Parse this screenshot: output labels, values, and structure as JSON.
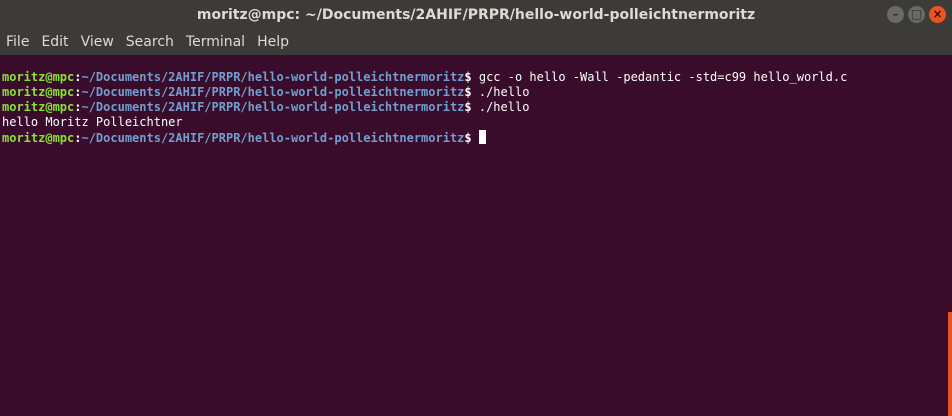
{
  "window": {
    "title": "moritz@mpc: ~/Documents/2AHIF/PRPR/hello-world-polleichtnermoritz",
    "buttons": {
      "minimize_glyph": "–",
      "maximize_glyph": "□",
      "close_glyph": "×"
    }
  },
  "menu": {
    "items": [
      "File",
      "Edit",
      "View",
      "Search",
      "Terminal",
      "Help"
    ]
  },
  "terminal": {
    "prompt_user": "moritz@mpc",
    "prompt_colon": ":",
    "prompt_path": "~/Documents/2AHIF/PRPR/hello-world-polleichtnermoritz",
    "prompt_symbol": "$",
    "commands": [
      " gcc -o hello -Wall -pedantic -std=c99 hello_world.c",
      " ./hello",
      " ./hello"
    ],
    "output": "hello Moritz Polleichtner",
    "last_command": " "
  },
  "colors": {
    "background": "#380c2a",
    "prompt_user": "#8ae234",
    "prompt_path": "#729fcf",
    "accent": "#e95420"
  }
}
